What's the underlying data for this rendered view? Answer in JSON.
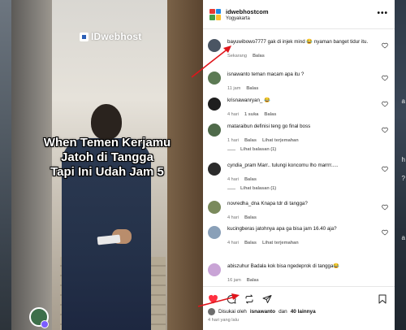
{
  "video": {
    "brand": "IDwebhost",
    "caption_lines": [
      "When Temen Kerjamu",
      "Jatoh di Tangga",
      "Tapi Ini Udah Jam 5"
    ]
  },
  "edge": {
    "right_letters": [
      "a",
      "h",
      "?",
      "a"
    ]
  },
  "post": {
    "account": "idwebhostcom",
    "location": "Yogyakarta"
  },
  "comments": [
    {
      "user": "bayuwibowo7777",
      "text": "gak di injek mind 😂 nyaman banget tidur itu.",
      "time": "Sekarang",
      "actions": [
        "Balas"
      ],
      "avatar_color": "#4a5563"
    },
    {
      "user": "isnawanto",
      "text": "teman macam apa itu ?",
      "time": "11 jam",
      "actions": [
        "Balas"
      ],
      "avatar_color": "#5c7a54"
    },
    {
      "user": "krisnawanryan_",
      "text": "😂",
      "time": "4 hari",
      "actions": [
        "1 suka",
        "Balas"
      ],
      "avatar_color": "#1e1e1e"
    },
    {
      "user": "mataraibun",
      "text": "definisi teng go final boss",
      "time": "1 hari",
      "actions": [
        "Balas",
        "Lihat terjemahan"
      ],
      "avatar_color": "#4f6a4a",
      "replies": "Lihat balasan (1)"
    },
    {
      "user": "cyndia_pram",
      "text": "Marr.. tulungi koncomu lho marrrr.....",
      "time": "4 hari",
      "actions": [
        "Balas"
      ],
      "avatar_color": "#2b2b2b",
      "replies": "Lihat balasan (1)"
    },
    {
      "user": "novredha_dna",
      "text": "Knapa tdr di tangga?",
      "time": "4 hari",
      "actions": [
        "Balas"
      ],
      "avatar_color": "#7a8a5c"
    },
    {
      "user": "kucingberas",
      "text": "jatohnya apa ga bisa jam 16.40 aja?",
      "time": "4 hari",
      "actions": [
        "Balas",
        "Lihat terjemahan"
      ],
      "avatar_color": "#8aa0b8"
    },
    {
      "user": "abiszuhur",
      "text": "Badala kok bisa ngedeprok di tangga😂",
      "time": "16 jam",
      "actions": [
        "Balas"
      ],
      "avatar_color": "#c9a4d6"
    }
  ],
  "likes": {
    "prefix": "Disukai oleh",
    "user": "isnawanto",
    "connector": "dan",
    "count": "40 lainnya"
  },
  "posted": "4 hari yang lalu",
  "colors": {
    "heart": "#ff3040",
    "arrow": "#e0151b",
    "muted": "#737373"
  },
  "logo_colors": [
    "#e53935",
    "#1e88e5",
    "#43a047",
    "#fbc02d"
  ]
}
